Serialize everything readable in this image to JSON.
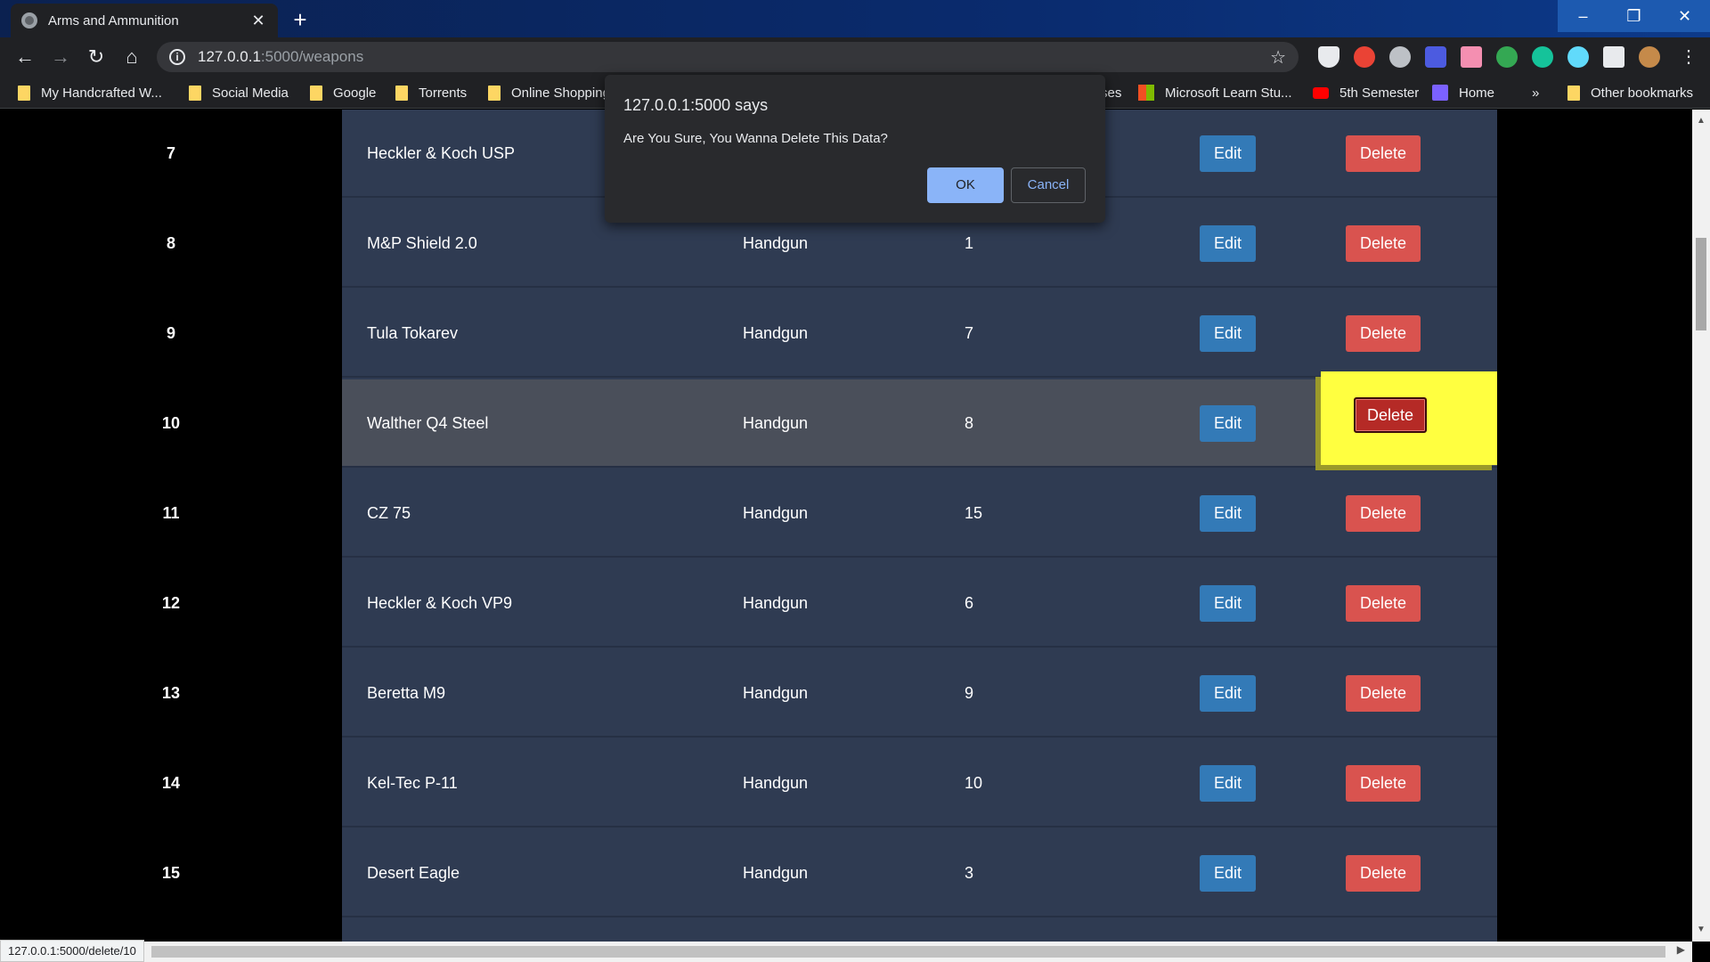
{
  "browser": {
    "tab_title": "Arms and Ammunition",
    "url_host": "127.0.0.1",
    "url_path": ":5000/weapons",
    "status_url": "127.0.0.1:5000/delete/10",
    "bookmarks": [
      "My Handcrafted W...",
      "Social Media",
      "Google",
      "Torrents",
      "Online Shopping",
      "ses",
      "Microsoft Learn Stu...",
      "5th Semester",
      "Home",
      "»",
      "Other bookmarks"
    ]
  },
  "dialog": {
    "title": "127.0.0.1:5000 says",
    "message": "Are You Sure, You Wanna Delete This Data?",
    "ok_label": "OK",
    "cancel_label": "Cancel"
  },
  "table": {
    "edit_label": "Edit",
    "delete_label": "Delete",
    "rows": [
      {
        "id": "7",
        "name": "Heckler & Koch USP",
        "type": "",
        "qty": ""
      },
      {
        "id": "8",
        "name": "M&P Shield 2.0",
        "type": "Handgun",
        "qty": "1"
      },
      {
        "id": "9",
        "name": "Tula Tokarev",
        "type": "Handgun",
        "qty": "7"
      },
      {
        "id": "10",
        "name": "Walther Q4 Steel",
        "type": "Handgun",
        "qty": "8"
      },
      {
        "id": "11",
        "name": "CZ 75",
        "type": "Handgun",
        "qty": "15"
      },
      {
        "id": "12",
        "name": "Heckler & Koch VP9",
        "type": "Handgun",
        "qty": "6"
      },
      {
        "id": "13",
        "name": "Beretta M9",
        "type": "Handgun",
        "qty": "9"
      },
      {
        "id": "14",
        "name": "Kel-Tec P-11",
        "type": "Handgun",
        "qty": "10"
      },
      {
        "id": "15",
        "name": "Desert Eagle",
        "type": "Handgun",
        "qty": "3"
      }
    ]
  }
}
